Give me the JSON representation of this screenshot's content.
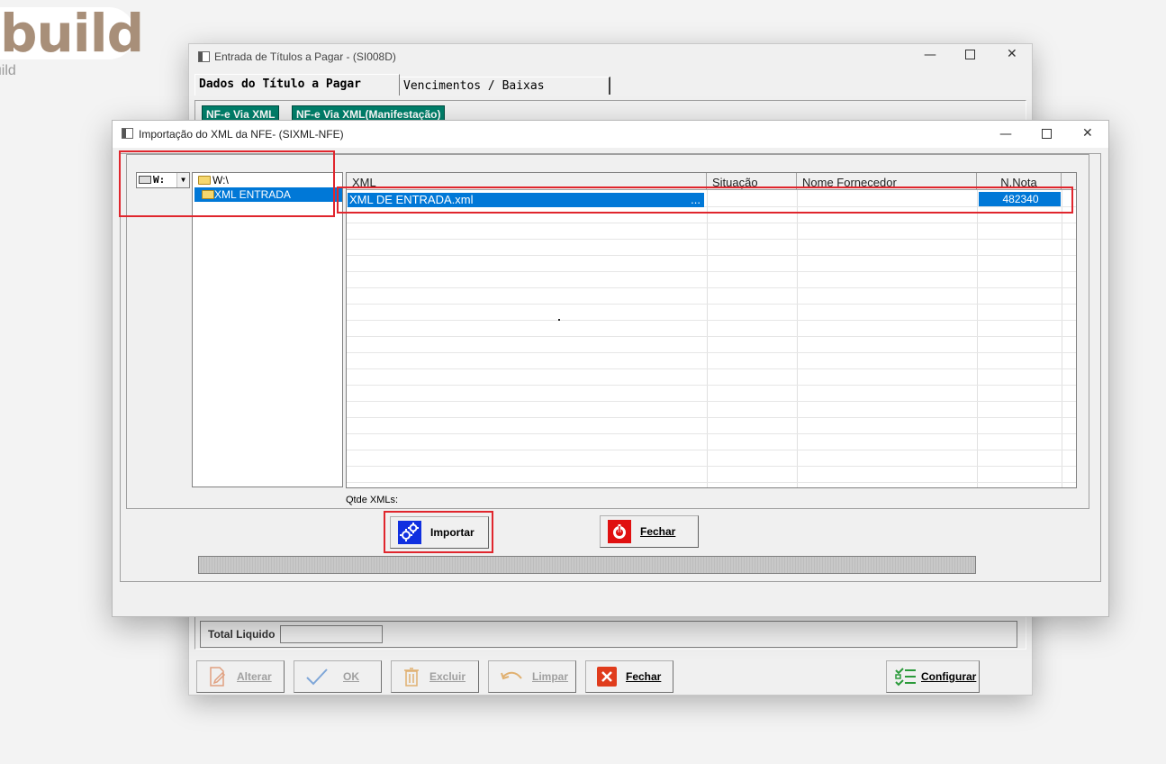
{
  "brand": {
    "text": "build",
    "sub": "build"
  },
  "back_window": {
    "title": "Entrada de Títulos a Pagar - (SI008D)",
    "tabs": [
      {
        "label": "Dados do Título a Pagar"
      },
      {
        "label": "Vencimentos / Baixas"
      }
    ],
    "nfe_buttons": [
      {
        "label": "NF-e Via XML"
      },
      {
        "label": "NF-e Via XML(Manifestação)"
      }
    ],
    "total_label": "Total Liquido",
    "total_value": "",
    "toolbar": {
      "alterar": "Alterar",
      "ok": "OK",
      "excluir": "Excluir",
      "limpar": "Limpar",
      "fechar": "Fechar",
      "configurar": "Configurar"
    }
  },
  "dialog": {
    "title": "Importação do XML da NFE- (SIXML-NFE)",
    "drive": "W:",
    "folders": [
      {
        "label": "W:\\",
        "selected": false
      },
      {
        "label": "XML ENTRADA",
        "selected": true
      }
    ],
    "grid": {
      "columns": [
        "XML",
        "Situação",
        "Nome Fornecedor",
        "N.Nota"
      ],
      "rows": [
        {
          "xml": "XML DE ENTRADA.xml",
          "ellipsis": "...",
          "situacao": "",
          "fornecedor": "",
          "nota": "482340"
        }
      ]
    },
    "qtde_label": "Qtde XMLs:",
    "importar_label": "Importar",
    "fechar_label": "Fechar",
    "progress": 0,
    "colors": {
      "selection": "#0078d7",
      "highlight": "#e0262d",
      "nfe_button": "#00806b"
    }
  }
}
